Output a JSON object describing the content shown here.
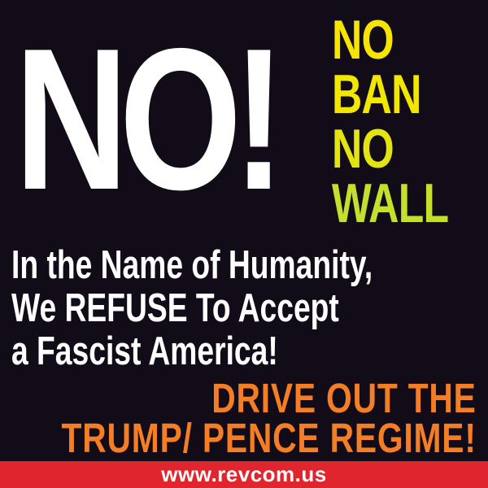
{
  "headline": "NO!",
  "slogans": [
    "NO",
    "BAN",
    "NO",
    "WALL"
  ],
  "statement": {
    "line1": "In the Name of Humanity,",
    "line2": "We REFUSE To Accept",
    "line3": "a Fascist America!"
  },
  "call_to_action": {
    "line1": "DRIVE OUT THE",
    "line2": "TRUMP/ PENCE REGIME!"
  },
  "footer": {
    "url": "www.revcom.us"
  },
  "colors": {
    "background": "#120c18",
    "headline": "#ffffff",
    "slogan": "#f7e400",
    "call_to_action": "#f47e26",
    "footer_bar": "#e0252e"
  }
}
